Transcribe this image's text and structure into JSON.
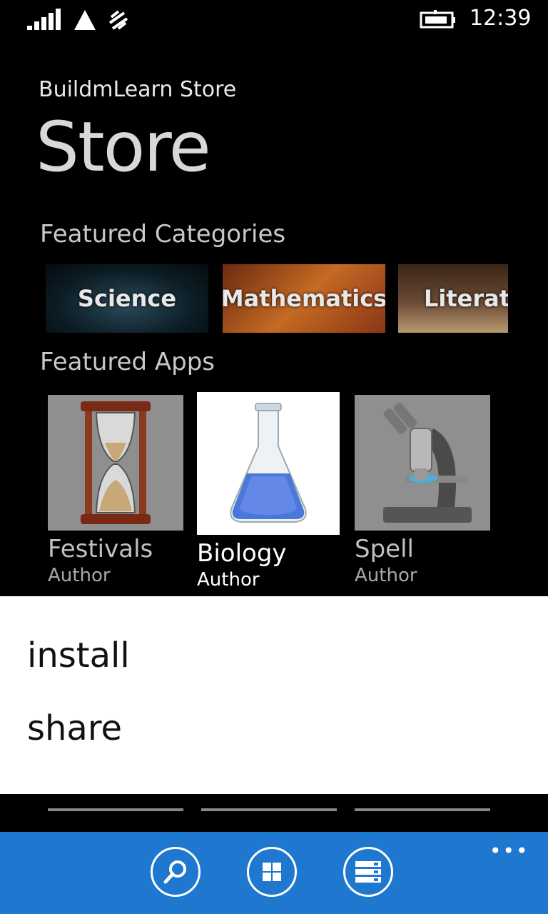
{
  "status_bar": {
    "time": "12:39"
  },
  "header": {
    "app_name": "BuildmLearn Store",
    "page_title": "Store"
  },
  "featured_categories": {
    "heading": "Featured Categories",
    "items": [
      {
        "label": "Science"
      },
      {
        "label": "Mathematics"
      },
      {
        "label": "Literatu"
      }
    ]
  },
  "featured_apps": {
    "heading": "Featured Apps",
    "items": [
      {
        "name": "Festivals",
        "author": "Author",
        "icon": "hourglass-icon"
      },
      {
        "name": "Biology",
        "author": "Author",
        "icon": "flask-icon",
        "selected": true
      },
      {
        "name": "Spell",
        "author": "Author",
        "icon": "microscope-icon"
      }
    ]
  },
  "context_menu": {
    "items": [
      "install",
      "share"
    ]
  },
  "app_bar": {
    "buttons": [
      {
        "icon": "search-icon"
      },
      {
        "icon": "categories-icon"
      },
      {
        "icon": "list-icon"
      }
    ],
    "more": "•••",
    "background": "#1e78d0"
  }
}
